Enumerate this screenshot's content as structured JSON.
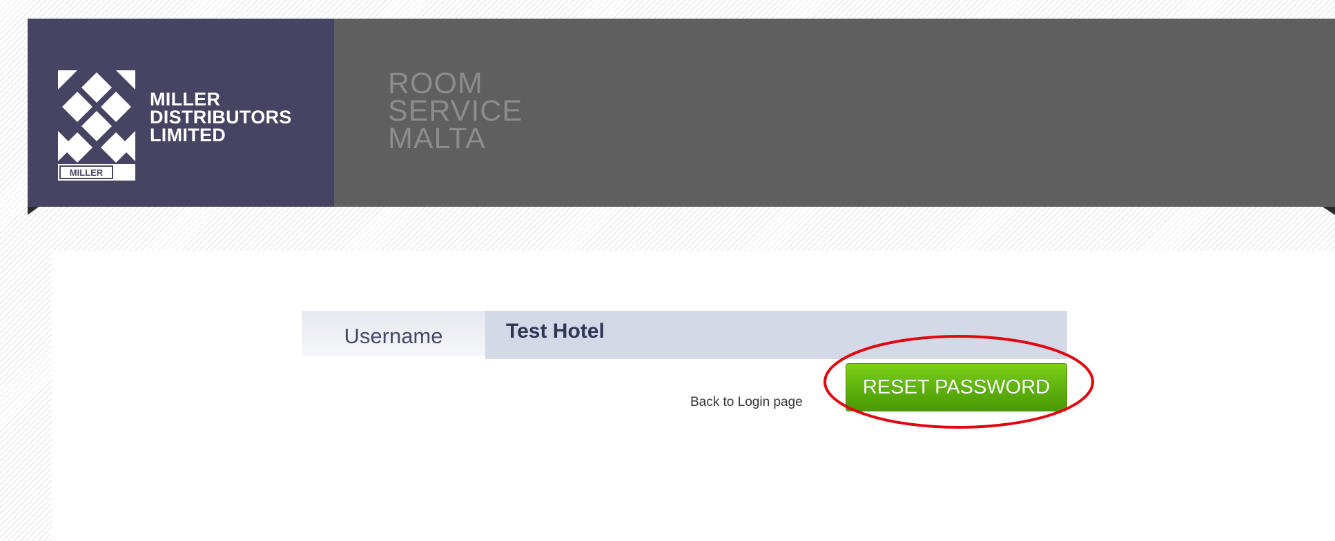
{
  "brand": {
    "logo_lines": [
      "MILLER",
      "DISTRIBUTORS",
      "LIMITED"
    ],
    "logo_badge": "MILLER",
    "colors": {
      "logo_panel": "#474463",
      "header": "#5f5f5f"
    }
  },
  "site_title": [
    "ROOM",
    "SERVICE",
    "MALTA"
  ],
  "form": {
    "username_label": "Username",
    "username_value": "Test Hotel",
    "back_link": "Back to Login page",
    "reset_button": "RESET PASSWORD",
    "colors": {
      "button": "#5fb30c",
      "highlight_ring": "#e3060f"
    }
  }
}
